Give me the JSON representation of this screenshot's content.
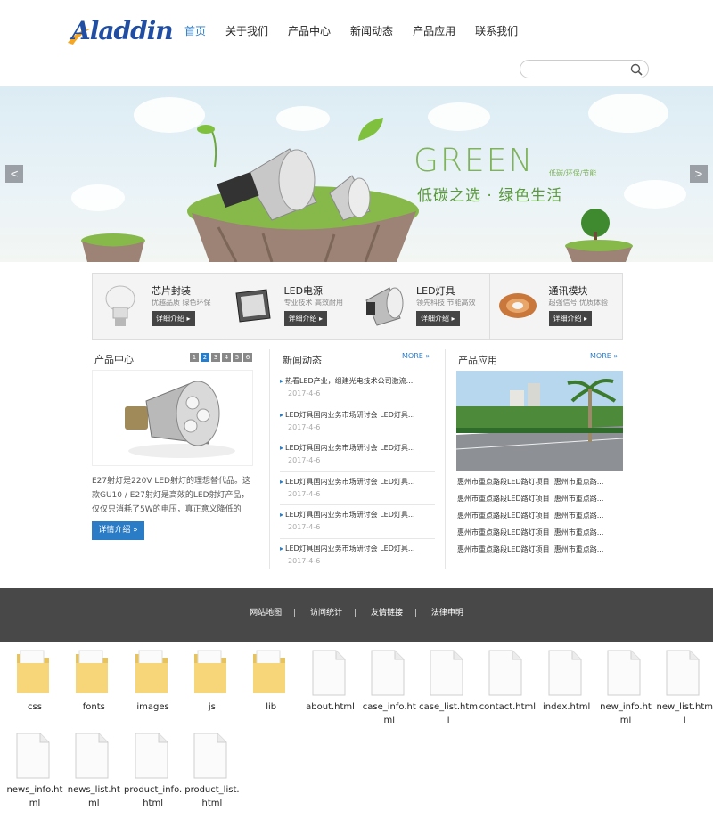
{
  "header": {
    "logo": "Aladdin",
    "nav": [
      "首页",
      "关于我们",
      "产品中心",
      "新闻动态",
      "产品应用",
      "联系我们"
    ],
    "search_placeholder": ""
  },
  "banner": {
    "headline": "GREEN",
    "tagline": "低碳/环保/节能",
    "slogan": "低碳之选 · 绿色生活",
    "prev": "<",
    "next": ">"
  },
  "products": [
    {
      "title": "芯片封装",
      "sub": "优越品质 绿色环保",
      "button": "详细介绍 ▸"
    },
    {
      "title": "LED电源",
      "sub": "专业技术 高效耐用",
      "button": "详细介绍 ▸"
    },
    {
      "title": "LED灯具",
      "sub": "领先科技 节能高效",
      "button": "详细介绍 ▸"
    },
    {
      "title": "通讯模块",
      "sub": "超强信号 优质体验",
      "button": "详细介绍 ▸"
    }
  ],
  "product_center": {
    "title": "产品中心",
    "pages": [
      "1",
      "2",
      "3",
      "4",
      "5",
      "6"
    ],
    "description": "E27射灯是220V LED射灯的理想替代品。这款GU10 / E27射灯是高效的LED射灯产品，仅仅只消耗了5W的电压，真正意义降低的",
    "button": "详情介绍 »"
  },
  "news": {
    "title": "新闻动态",
    "more": "MORE »",
    "items": [
      {
        "title": "热看LED产业，组建光电技术公司激流...",
        "date": "2017-4-6"
      },
      {
        "title": "LED灯具国内业务市场研讨会 LED灯具...",
        "date": "2017-4-6"
      },
      {
        "title": "LED灯具国内业务市场研讨会 LED灯具...",
        "date": "2017-4-6"
      },
      {
        "title": "LED灯具国内业务市场研讨会 LED灯具...",
        "date": "2017-4-6"
      },
      {
        "title": "LED灯具国内业务市场研讨会 LED灯具...",
        "date": "2017-4-6"
      },
      {
        "title": "LED灯具国内业务市场研讨会 LED灯具...",
        "date": "2017-4-6"
      }
    ]
  },
  "applications": {
    "title": "产品应用",
    "more": "MORE »",
    "items": [
      "惠州市重点路段LED路灯项目 ·惠州市重点路...",
      "惠州市重点路段LED路灯项目 ·惠州市重点路...",
      "惠州市重点路段LED路灯项目 ·惠州市重点路...",
      "惠州市重点路段LED路灯项目 ·惠州市重点路...",
      "惠州市重点路段LED路灯项目 ·惠州市重点路..."
    ]
  },
  "footer": {
    "links": [
      "网站地图",
      "访问统计",
      "友情链接",
      "法律申明"
    ],
    "separator": "|"
  },
  "files": [
    {
      "name": "css",
      "type": "folder"
    },
    {
      "name": "fonts",
      "type": "folder"
    },
    {
      "name": "images",
      "type": "folder"
    },
    {
      "name": "js",
      "type": "folder"
    },
    {
      "name": "lib",
      "type": "folder"
    },
    {
      "name": "about.html",
      "type": "file"
    },
    {
      "name": "case_info.html",
      "type": "file"
    },
    {
      "name": "case_list.html",
      "type": "file"
    },
    {
      "name": "contact.html",
      "type": "file"
    },
    {
      "name": "index.html",
      "type": "file"
    },
    {
      "name": "new_info.html",
      "type": "file"
    },
    {
      "name": "new_list.html",
      "type": "file"
    },
    {
      "name": "news_info.html",
      "type": "file"
    },
    {
      "name": "news_list.html",
      "type": "file"
    },
    {
      "name": "product_info.html",
      "type": "file"
    },
    {
      "name": "product_list.html",
      "type": "file"
    }
  ],
  "colors": {
    "accent": "#2a7cc7",
    "footer": "#484848",
    "green": "#7fb35a"
  }
}
